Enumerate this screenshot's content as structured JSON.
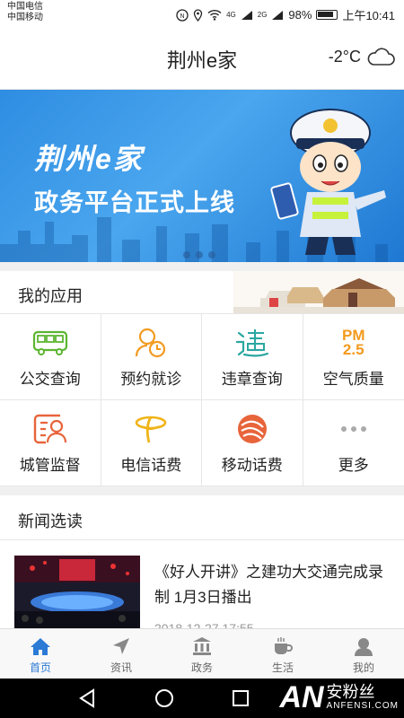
{
  "status_bar": {
    "carrier1": "中国电信",
    "carrier2": "中国移动",
    "signal_1": "4G",
    "signal_2": "2G",
    "battery": "98%",
    "time": "上午10:41"
  },
  "header": {
    "title": "荆州e家",
    "temperature": "-2°C",
    "weather_icon": "cloud-icon"
  },
  "banner": {
    "logo_text": "荆州e家",
    "slogan": "政务平台正式上线",
    "dot_count": 3,
    "active_dot": 1
  },
  "apps": {
    "title": "我的应用",
    "items": [
      {
        "label": "公交查询",
        "icon": "bus-icon",
        "color": "#5cb531"
      },
      {
        "label": "预约就诊",
        "icon": "doctor-clock-icon",
        "color": "#f39a1f"
      },
      {
        "label": "违章查询",
        "icon": "violation-icon",
        "color": "#2aa7a0"
      },
      {
        "label": "空气质量",
        "icon": "pm25-icon",
        "pm_top": "PM",
        "pm_bottom": "2.5",
        "color": "#f39a1f"
      },
      {
        "label": "城管监督",
        "icon": "urban-management-icon",
        "color": "#e8643a"
      },
      {
        "label": "电信话费",
        "icon": "china-telecom-icon",
        "color": "#f0b418"
      },
      {
        "label": "移动话费",
        "icon": "china-mobile-icon",
        "color": "#e8643a"
      },
      {
        "label": "更多",
        "icon": "more-dots-icon",
        "color": "#aaaaaa"
      }
    ]
  },
  "news": {
    "title": "新闻选读",
    "items": [
      {
        "headline": "《好人开讲》之建功大交通完成录制 1月3日播出",
        "date": "2018-12-27 17:55"
      }
    ]
  },
  "tabs": [
    {
      "label": "首页",
      "icon": "home-icon",
      "active": true
    },
    {
      "label": "资讯",
      "icon": "navigation-arrow-icon",
      "active": false
    },
    {
      "label": "政务",
      "icon": "government-building-icon",
      "active": false
    },
    {
      "label": "生活",
      "icon": "coffee-cup-icon",
      "active": false
    },
    {
      "label": "我的",
      "icon": "user-icon",
      "active": false
    }
  ],
  "colors": {
    "accent": "#2b7ad6",
    "banner_blue": "#3a9ae8",
    "divider": "#e6e6e6"
  },
  "watermark": {
    "logo": "AN",
    "cn": "安粉丝",
    "en": "ANFENSI.COM"
  }
}
